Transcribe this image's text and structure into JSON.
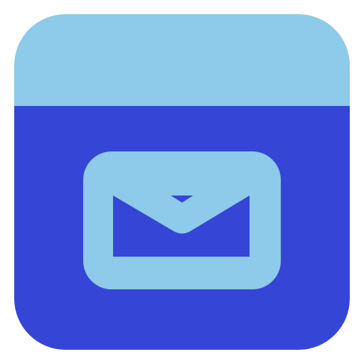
{
  "icon": {
    "name": "mail-app-icon",
    "glyph": "envelope-icon"
  },
  "colors": {
    "header": "#8ecae9",
    "body": "#3546d6",
    "glyph": "#8ecae9",
    "background": "#ffffff"
  }
}
